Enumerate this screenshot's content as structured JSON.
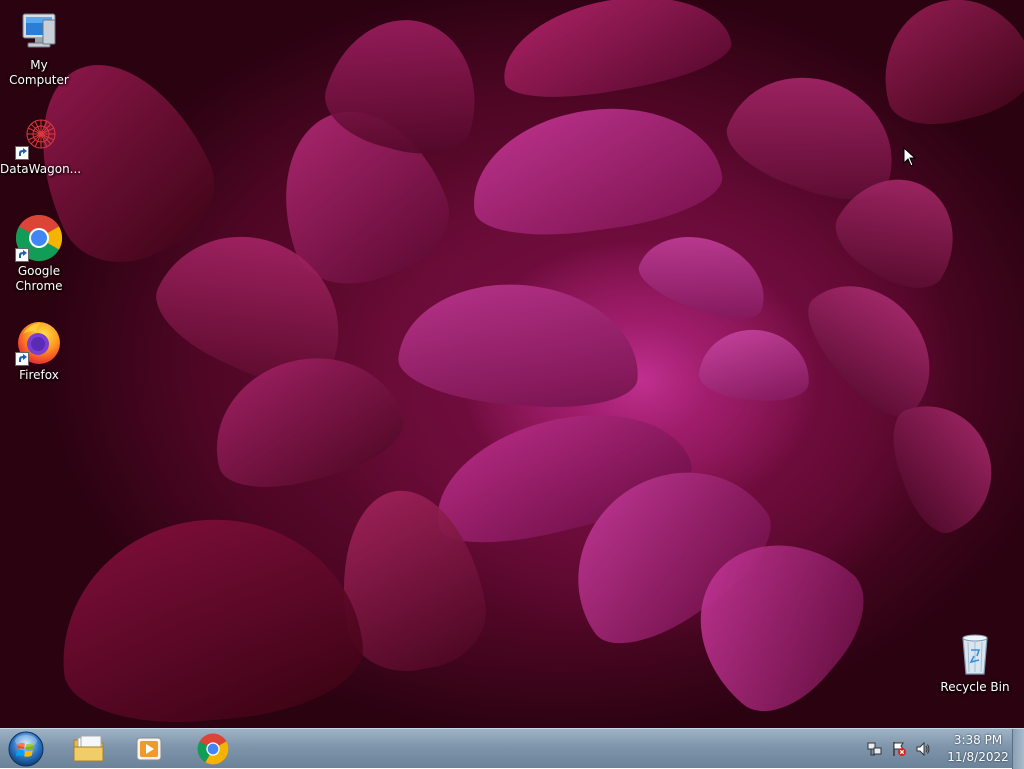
{
  "desktop": {
    "icons": [
      {
        "label": "My Computer",
        "icon": "computer-icon"
      },
      {
        "label": "DataWagon...",
        "icon": "datawagon-icon"
      },
      {
        "label": "Google Chrome",
        "icon": "chrome-icon"
      },
      {
        "label": "Firefox",
        "icon": "firefox-icon"
      },
      {
        "label": "Recycle Bin",
        "icon": "recycle-bin-icon"
      }
    ],
    "wallpaper_colors": {
      "center": "#c0308f",
      "mid": "#8c1652",
      "outer": "#3a0418"
    }
  },
  "taskbar": {
    "start_button_icon": "windows-orb-icon",
    "pinned": [
      {
        "name": "explorer",
        "icon": "folder-icon"
      },
      {
        "name": "media-player",
        "icon": "media-player-icon"
      },
      {
        "name": "chrome",
        "icon": "chrome-icon"
      }
    ],
    "tray": {
      "icons": [
        "network-icon",
        "action-center-icon",
        "volume-icon"
      ],
      "time": "3:38 PM",
      "date": "11/8/2022"
    }
  }
}
